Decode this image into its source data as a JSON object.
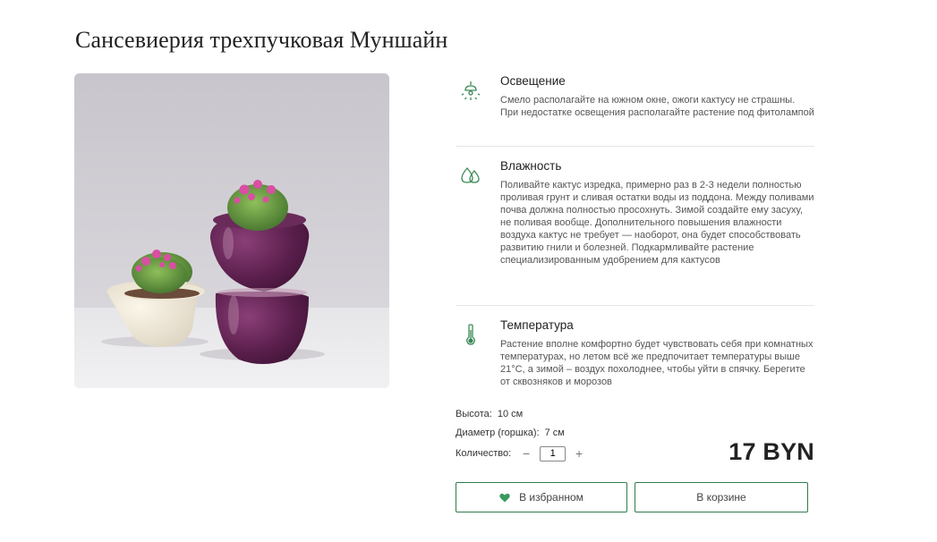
{
  "product": {
    "title": "Сансевиерия трехпучковая Муншайн",
    "photo_alt": "cacti in pots"
  },
  "care": [
    {
      "icon": "lamp-icon",
      "title": "Освещение",
      "text": "Смело располагайте на южном окне, ожоги кактусу не страшны. При недостатке освещения располагайте растение под фитолампой"
    },
    {
      "icon": "water-drops-icon",
      "title": "Влажность",
      "text": "Поливайте кактус изредка, примерно раз в 2-3 недели полностью проливая грунт и сливая остатки воды из поддона. Между поливами почва должна полностью просохнуть. Зимой создайте ему засуху, не поливая вообще. Дополнительного повышения влажности воздуха кактус не требует — наоборот, она будет способствовать развитию гнили и болезней. Подкармливайте растение специализированным удобрением для кактусов"
    },
    {
      "icon": "thermometer-icon",
      "title": "Температура",
      "text": "Растение вполне комфортно будет чувствовать себя при комнатных температурах, но летом всё же предпочитает температуры выше 21°С, а зимой – воздух похолоднее, чтобы уйти в спячку. Берегите от сквозняков и морозов"
    }
  ],
  "specs": {
    "height_label": "Высота:",
    "height_value": "10 см",
    "diameter_label": "Диаметр (горшка):",
    "diameter_value": "7 см",
    "quantity_label": "Количество:",
    "quantity_value": "1",
    "minus": "−",
    "plus": "+"
  },
  "price": "17 BYN",
  "buttons": {
    "favorite": "В избранном",
    "cart": "В корзине"
  },
  "colors": {
    "accent": "#2e7d4a",
    "heart": "#3a9a5c"
  }
}
